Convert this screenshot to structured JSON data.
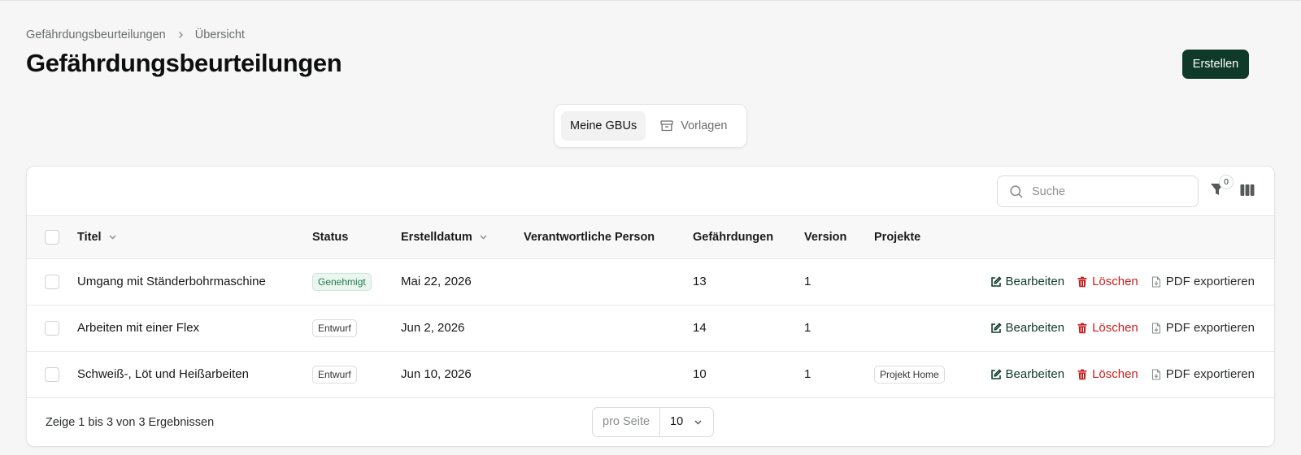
{
  "breadcrumb": {
    "items": [
      "Gefährdungsbeurteilungen",
      "Übersicht"
    ]
  },
  "page": {
    "title": "Gefährdungsbeurteilungen",
    "create_label": "Erstellen"
  },
  "tabs": [
    {
      "label": "Meine GBUs",
      "active": true
    },
    {
      "label": "Vorlagen",
      "icon": "archive-icon",
      "active": false
    }
  ],
  "toolbar": {
    "search_placeholder": "Suche",
    "filter_count": "0"
  },
  "table": {
    "columns": {
      "title": "Titel",
      "status": "Status",
      "created": "Erstelldatum",
      "responsible": "Verantwortliche Person",
      "hazards": "Gefährdungen",
      "version": "Version",
      "projects": "Projekte"
    },
    "actions": {
      "edit": "Bearbeiten",
      "delete": "Löschen",
      "pdf": "PDF exportieren"
    },
    "rows": [
      {
        "title": "Umgang mit Ständerbohrmaschine",
        "status": "Genehmigt",
        "status_type": "approved",
        "created": "Mai 22, 2026",
        "responsible": "",
        "hazards": "13",
        "version": "1",
        "project": ""
      },
      {
        "title": "Arbeiten mit einer Flex",
        "status": "Entwurf",
        "status_type": "draft",
        "created": "Jun 2, 2026",
        "responsible": "",
        "hazards": "14",
        "version": "1",
        "project": ""
      },
      {
        "title": "Schweiß-, Löt und Heißarbeiten",
        "status": "Entwurf",
        "status_type": "draft",
        "created": "Jun 10, 2026",
        "responsible": "",
        "hazards": "10",
        "version": "1",
        "project": "Projekt Home"
      }
    ]
  },
  "footer": {
    "results_text": "Zeige 1 bis 3 von 3 Ergebnissen",
    "per_page_label": "pro Seite",
    "per_page_value": "10"
  },
  "colors": {
    "primary": "#0f3a2a",
    "danger": "#c81e1e",
    "approved": "#1f7a4d",
    "background": "#f5f6f5"
  }
}
